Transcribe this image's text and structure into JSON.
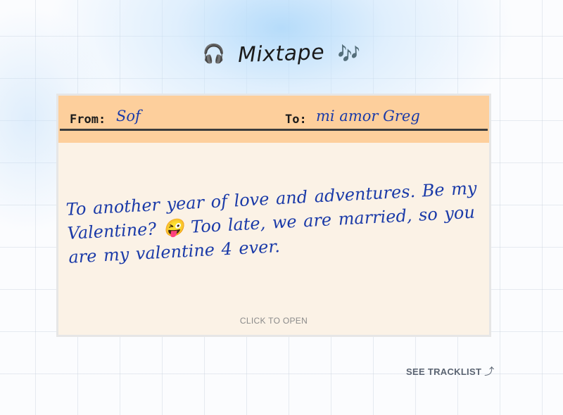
{
  "header": {
    "headphones_icon": "🎧",
    "title": "Mixtape",
    "notes_icon": "🎶"
  },
  "card": {
    "from_label": "From:",
    "from_value": "Sof",
    "to_label": "To:",
    "to_value": "mi amor Greg",
    "message": "To another year of love and adventures. Be my Valentine? 😜 Too late, we are married, so you are my valentine 4 ever.",
    "open_hint": "CLICK TO OPEN"
  },
  "footer": {
    "tracklist_label": "SEE TRACKLIST",
    "tracklist_arrow": "⤴"
  },
  "colors": {
    "card_header": "#fdcf9c",
    "card_body": "#fbf2e6",
    "handwriting": "#1a3aa8",
    "link": "#5b6472"
  }
}
